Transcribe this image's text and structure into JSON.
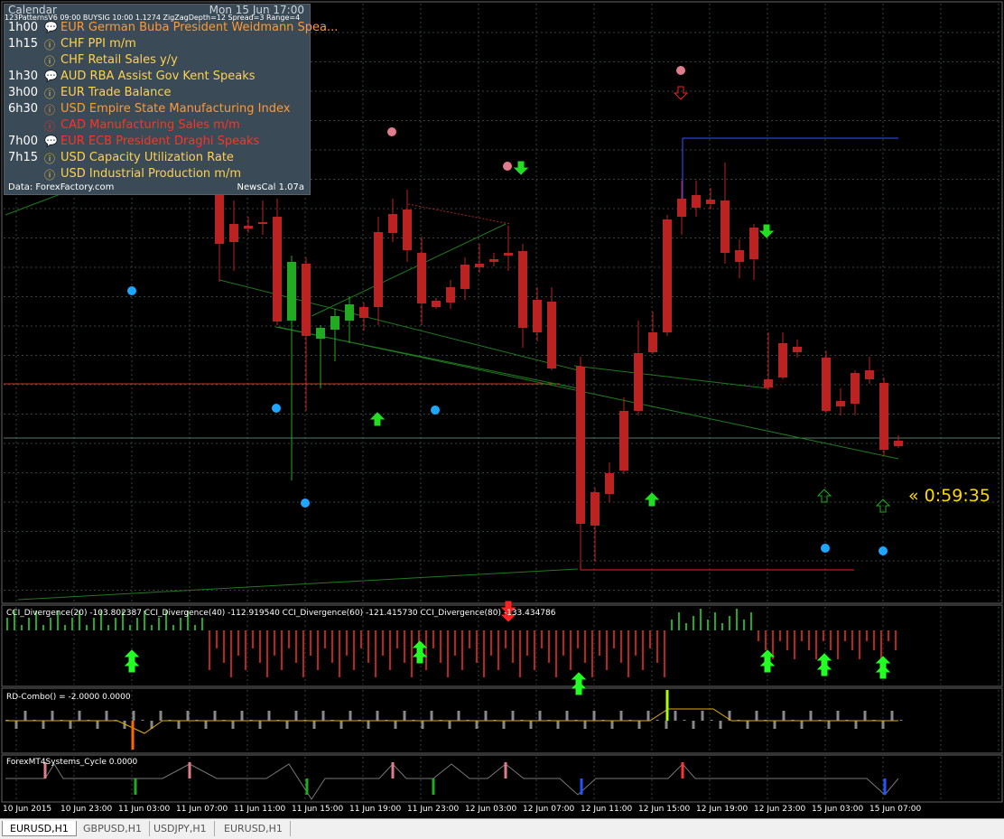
{
  "calendar": {
    "title": "Calendar",
    "date": "Mon 15 Jun 17:00",
    "pattern_line": "123PatternsV6  09:00  BUYSIG  10:00  1.1274  ZigZagDepth=12  Spread=3  Range=4",
    "events": [
      {
        "time": "1h00",
        "icon": "💬",
        "text": "EUR German Buba President Weidmann Spea...",
        "color": "#ff9933"
      },
      {
        "time": "1h15",
        "icon": "ⓘ",
        "text": "CHF PPI m/m",
        "color": "#ffd24d"
      },
      {
        "time": "",
        "icon": "ⓘ",
        "text": "CHF Retail Sales y/y",
        "color": "#ffd24d"
      },
      {
        "time": "1h30",
        "icon": "💬",
        "text": "AUD RBA Assist Gov Kent Speaks",
        "color": "#ffd24d"
      },
      {
        "time": "3h00",
        "icon": "ⓘ",
        "text": "EUR Trade Balance",
        "color": "#ffd24d"
      },
      {
        "time": "6h30",
        "icon": "ⓘ",
        "text": "USD Empire State Manufacturing Index",
        "color": "#ff9933"
      },
      {
        "time": "",
        "icon": "ⓘ",
        "text": "CAD Manufacturing Sales m/m",
        "color": "#ff3322"
      },
      {
        "time": "7h00",
        "icon": "💬",
        "text": "EUR ECB President Draghi Speaks",
        "color": "#ff3322"
      },
      {
        "time": "7h15",
        "icon": "ⓘ",
        "text": "USD Capacity Utilization Rate",
        "color": "#ffd24d"
      },
      {
        "time": "",
        "icon": "ⓘ",
        "text": "USD Industrial Production m/m",
        "color": "#ffd24d"
      }
    ],
    "footer_left": "Data: ForexFactory.com",
    "footer_right": "NewsCal 1.07a"
  },
  "countdown": "« 0:59:35",
  "indicators": {
    "cci_label": "CCI_Divergence(20) -103.802387  CCI_Divergence(40) -112.919540  CCI_Divergence(60) -121.415730  CCI_Divergence(80) -133.434786",
    "rd_label": "RD-Combo() = -2.0000 0.0000",
    "cycle_label": "ForexMT4Systems_Cycle 0.0000"
  },
  "x_axis": [
    "10 Jun 2015",
    "10 Jun 23:00",
    "11 Jun 03:00",
    "11 Jun 07:00",
    "11 Jun 11:00",
    "11 Jun 15:00",
    "11 Jun 19:00",
    "11 Jun 23:00",
    "12 Jun 03:00",
    "12 Jun 07:00",
    "12 Jun 11:00",
    "12 Jun 15:00",
    "12 Jun 19:00",
    "12 Jun 23:00",
    "15 Jun 03:00",
    "15 Jun 07:00"
  ],
  "tabs": [
    "EURUSD,H1",
    "GBPUSD,H1",
    "USDJPY,H1",
    "EURUSD,H1"
  ],
  "colors": {
    "bull": "#22aa22",
    "bear": "#bb2222",
    "grid": "#33443a",
    "countdown": "#ffd800"
  }
}
